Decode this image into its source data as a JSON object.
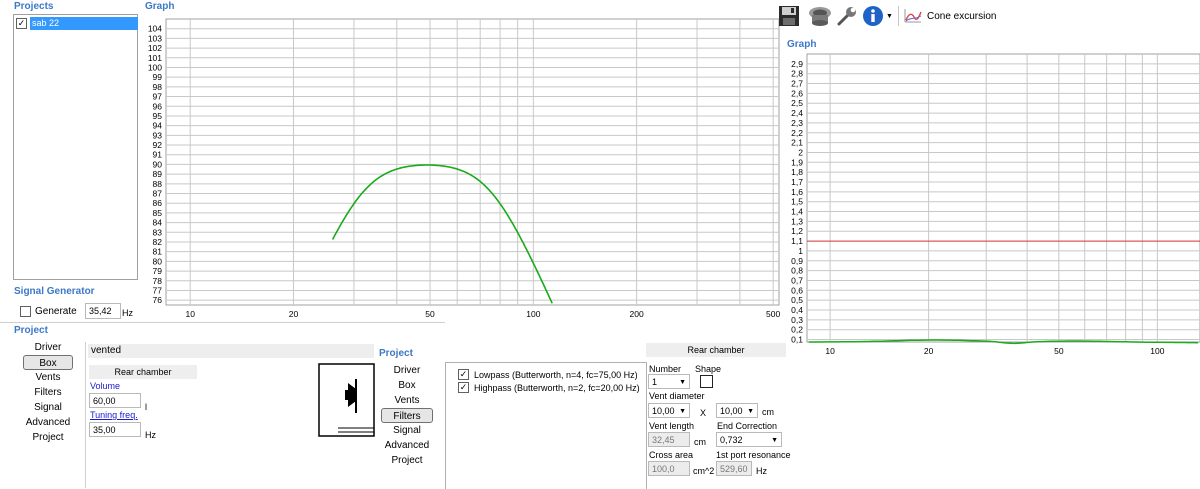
{
  "projects": {
    "title": "Projects",
    "items": [
      {
        "name": "sab 22",
        "checked": true
      }
    ]
  },
  "signal_generator": {
    "title": "Signal Generator",
    "generate_label": "Generate",
    "freq_value": "35,42",
    "freq_unit": "Hz"
  },
  "graph_left": {
    "title": "Graph",
    "y_ticks": [
      "104",
      "103",
      "102",
      "101",
      "100",
      "99",
      "98",
      "97",
      "96",
      "95",
      "94",
      "93",
      "92",
      "91",
      "90",
      "89",
      "88",
      "87",
      "86",
      "85",
      "84",
      "83",
      "82",
      "81",
      "80",
      "79",
      "78",
      "77",
      "76"
    ],
    "x_ticks": [
      "10",
      "20",
      "50",
      "100",
      "200",
      "500"
    ]
  },
  "toolbar": {
    "save_icon": "floppy-disk-icon",
    "driver_icon": "speaker-driver-icon",
    "settings_icon": "wrench-icon",
    "info_icon": "info-icon",
    "cone_label": "Cone excursion"
  },
  "graph_right": {
    "title": "Graph",
    "y_ticks": [
      "2,9",
      "2,8",
      "2,7",
      "2,6",
      "2,5",
      "2,4",
      "2,3",
      "2,2",
      "2,1",
      "2",
      "1,9",
      "1,8",
      "1,7",
      "1,6",
      "1,5",
      "1,4",
      "1,3",
      "1,2",
      "1,1",
      "1",
      "0,9",
      "0,8",
      "0,7",
      "0,6",
      "0,5",
      "0,4",
      "0,3",
      "0,2",
      "0,1"
    ],
    "x_ticks": [
      "10",
      "20",
      "50",
      "100"
    ],
    "limit_color": "#d83c3c"
  },
  "project_left": {
    "title": "Project",
    "nav": [
      "Driver",
      "Box",
      "Vents",
      "Filters",
      "Signal",
      "Advanced",
      "Project"
    ],
    "active": "Box",
    "box_type": "vented",
    "rear_chamber": "Rear chamber",
    "volume_label": "Volume",
    "volume_value": "60,00",
    "volume_unit": "l",
    "tuning_label": "Tuning freq.",
    "tuning_value": "35,00",
    "tuning_unit": "Hz"
  },
  "project_middle": {
    "title": "Project",
    "nav": [
      "Driver",
      "Box",
      "Vents",
      "Filters",
      "Signal",
      "Advanced",
      "Project"
    ],
    "active": "Filters",
    "filters": [
      {
        "label": "Lowpass (Butterworth, n=4, fc=75,00 Hz)",
        "checked": true
      },
      {
        "label": "Highpass (Butterworth, n=2, fc=20,00 Hz)",
        "checked": true
      }
    ]
  },
  "vents": {
    "rear_chamber": "Rear chamber",
    "number_label": "Number",
    "number_value": "1",
    "shape_label": "Shape",
    "vent_diameter_label": "Vent diameter",
    "diam_1": "10,00",
    "diam_x": "X",
    "diam_2": "10,00",
    "diam_unit": "cm",
    "vent_length_label": "Vent length",
    "vent_length_value": "32,45",
    "vent_length_unit": "cm",
    "end_corr_label": "End Correction",
    "end_corr_value": "0,732",
    "cross_area_label": "Cross area",
    "cross_area_value": "100,0",
    "cross_area_unit": "cm^2",
    "port_res_label": "1st port resonance",
    "port_res_value": "529,60",
    "port_res_unit": "Hz"
  },
  "colors": {
    "curve": "#1aaa1a",
    "accent": "#3c78c8",
    "selection": "#3399ff"
  }
}
